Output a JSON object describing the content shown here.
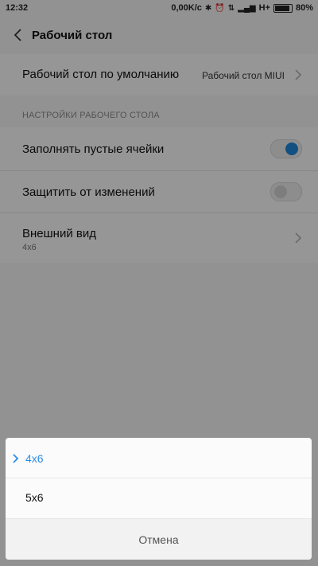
{
  "status_bar": {
    "time": "12:32",
    "net_speed": "0,00K/c",
    "network": "H+",
    "battery": "80%"
  },
  "app_bar": {
    "title": "Рабочий стол"
  },
  "default_desktop": {
    "label": "Рабочий стол по умолчанию",
    "value": "Рабочий стол MIUI"
  },
  "section_header": "НАСТРОЙКИ РАБОЧЕГО СТОЛА",
  "fill_empty": {
    "label": "Заполнять пустые ячейки",
    "enabled": true
  },
  "protect": {
    "label": "Защитить от изменений",
    "enabled": false
  },
  "appearance": {
    "label": "Внешний вид",
    "value": "4x6"
  },
  "sheet": {
    "options": [
      {
        "label": "4x6",
        "selected": true
      },
      {
        "label": "5x6",
        "selected": false
      }
    ],
    "cancel_label": "Отмена"
  },
  "colors": {
    "accent": "#2a8de6",
    "toggle_on": "#1e86d8"
  }
}
